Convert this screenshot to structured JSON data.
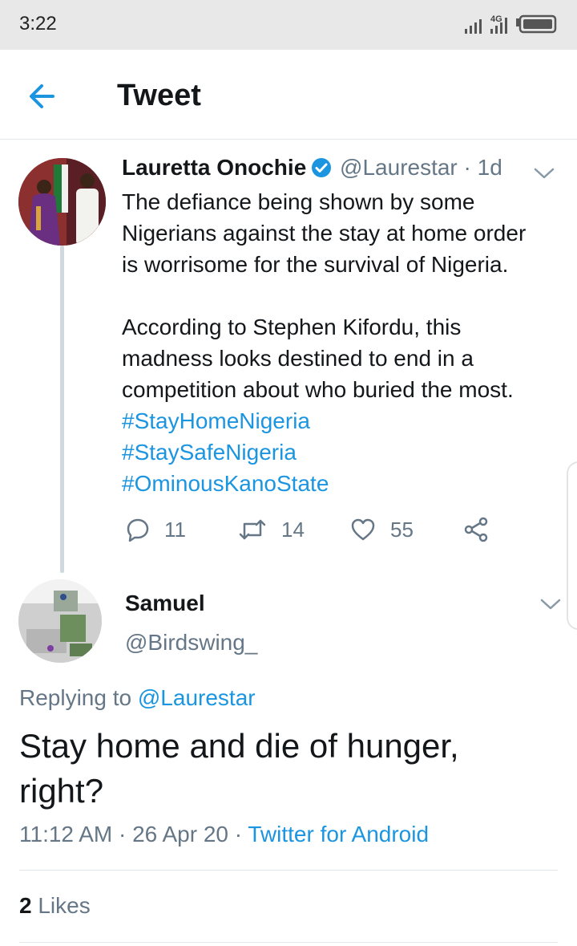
{
  "status_bar": {
    "time": "3:22",
    "network": "4G"
  },
  "header": {
    "title": "Tweet"
  },
  "tweet": {
    "author_name": "Lauretta Onochie",
    "author_handle": "@Laurestar",
    "time_ago": "· 1d",
    "lines_1": [
      "The defiance being shown by some",
      "Nigerians against the stay at home order",
      "is worrisome for the survival of Nigeria."
    ],
    "lines_2": [
      "According to Stephen Kifordu, this",
      "madness looks destined to end in a",
      "competition about who buried the most."
    ],
    "hashtags": [
      "#StayHomeNigeria",
      "#StaySafeNigeria",
      "#OminousKanoState"
    ],
    "reply_count": "11",
    "retweet_count": "14",
    "like_count": "55"
  },
  "reply": {
    "author_name": "Samuel",
    "author_handle": "@Birdswing_",
    "replying_to_label": "Replying to",
    "replying_to_handle": "@Laurestar",
    "text": "Stay home and die of hunger, right?",
    "timestamp": "11:12 AM · 26 Apr 20 ·",
    "source": "Twitter for Android",
    "likes_count": "2",
    "likes_label": "Likes"
  },
  "colors": {
    "accent": "#1b95e0",
    "secondary_text": "#657786",
    "primary_text": "#14171a"
  }
}
